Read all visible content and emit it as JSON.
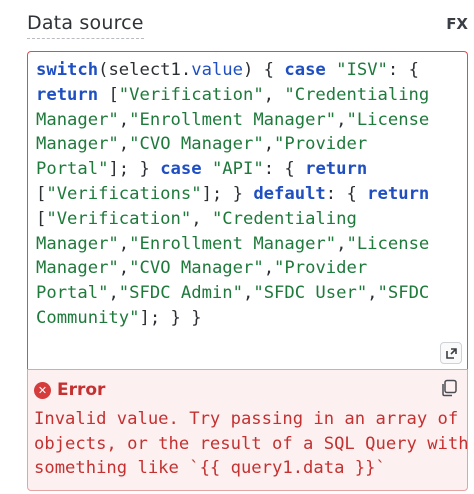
{
  "field": {
    "label": "Data source",
    "fx_label": "FX"
  },
  "editor": {
    "code_lines": [
      [
        {
          "t": "kw",
          "v": "switch"
        },
        {
          "t": "plain",
          "v": "(select1."
        },
        {
          "t": "prop",
          "v": "value"
        },
        {
          "t": "plain",
          "v": ") { "
        },
        {
          "t": "kw",
          "v": "case"
        },
        {
          "t": "plain",
          "v": " "
        },
        {
          "t": "str",
          "v": "\"ISV\""
        },
        {
          "t": "plain",
          "v": ": {"
        }
      ],
      [
        {
          "t": "kw",
          "v": "return"
        },
        {
          "t": "plain",
          "v": " ["
        },
        {
          "t": "str",
          "v": "\"Verification\""
        },
        {
          "t": "plain",
          "v": ", "
        },
        {
          "t": "str",
          "v": "\"Credentialing"
        }
      ],
      [
        {
          "t": "str",
          "v": "Manager\""
        },
        {
          "t": "plain",
          "v": ","
        },
        {
          "t": "str",
          "v": "\"Enrollment Manager\""
        },
        {
          "t": "plain",
          "v": ","
        },
        {
          "t": "str",
          "v": "\"License"
        }
      ],
      [
        {
          "t": "str",
          "v": "Manager\""
        },
        {
          "t": "plain",
          "v": ","
        },
        {
          "t": "str",
          "v": "\"CVO Manager\""
        },
        {
          "t": "plain",
          "v": ","
        },
        {
          "t": "str",
          "v": "\"Provider"
        }
      ],
      [
        {
          "t": "str",
          "v": "Portal\""
        },
        {
          "t": "plain",
          "v": "]; } "
        },
        {
          "t": "kw",
          "v": "case"
        },
        {
          "t": "plain",
          "v": " "
        },
        {
          "t": "str",
          "v": "\"API\""
        },
        {
          "t": "plain",
          "v": ": { "
        },
        {
          "t": "kw",
          "v": "return"
        }
      ],
      [
        {
          "t": "plain",
          "v": "["
        },
        {
          "t": "str",
          "v": "\"Verifications\""
        },
        {
          "t": "plain",
          "v": "]; } "
        },
        {
          "t": "kw",
          "v": "default"
        },
        {
          "t": "plain",
          "v": ": { "
        },
        {
          "t": "kw",
          "v": "return"
        }
      ],
      [
        {
          "t": "plain",
          "v": "["
        },
        {
          "t": "str",
          "v": "\"Verification\""
        },
        {
          "t": "plain",
          "v": ", "
        },
        {
          "t": "str",
          "v": "\"Credentialing"
        }
      ],
      [
        {
          "t": "str",
          "v": "Manager\""
        },
        {
          "t": "plain",
          "v": ","
        },
        {
          "t": "str",
          "v": "\"Enrollment Manager\""
        },
        {
          "t": "plain",
          "v": ","
        },
        {
          "t": "str",
          "v": "\"License"
        }
      ],
      [
        {
          "t": "str",
          "v": "Manager\""
        },
        {
          "t": "plain",
          "v": ","
        },
        {
          "t": "str",
          "v": "\"CVO Manager\""
        },
        {
          "t": "plain",
          "v": ","
        },
        {
          "t": "str",
          "v": "\"Provider"
        }
      ],
      [
        {
          "t": "str",
          "v": "Portal\""
        },
        {
          "t": "plain",
          "v": ","
        },
        {
          "t": "str",
          "v": "\"SFDC Admin\""
        },
        {
          "t": "plain",
          "v": ","
        },
        {
          "t": "str",
          "v": "\"SFDC User\""
        },
        {
          "t": "plain",
          "v": ","
        },
        {
          "t": "str",
          "v": "\"SFDC"
        }
      ],
      [
        {
          "t": "str",
          "v": "Community\""
        },
        {
          "t": "plain",
          "v": "]; } }"
        }
      ]
    ],
    "resize_icon": "expand-icon"
  },
  "error": {
    "icon": "error-circle-icon",
    "icon_glyph": "✕",
    "title": "Error",
    "copy_icon": "copy-icon",
    "message_lines": [
      "Invalid value. Try passing in an array of",
      "objects, or the result of a SQL Query with",
      "something like `{{ query1.data }}`"
    ]
  },
  "colors": {
    "error_red": "#c43131",
    "error_bg": "#fdf0f0",
    "editor_border": "#d94f4f",
    "keyword": "#1f4fc1",
    "string": "#1e7a3b"
  }
}
